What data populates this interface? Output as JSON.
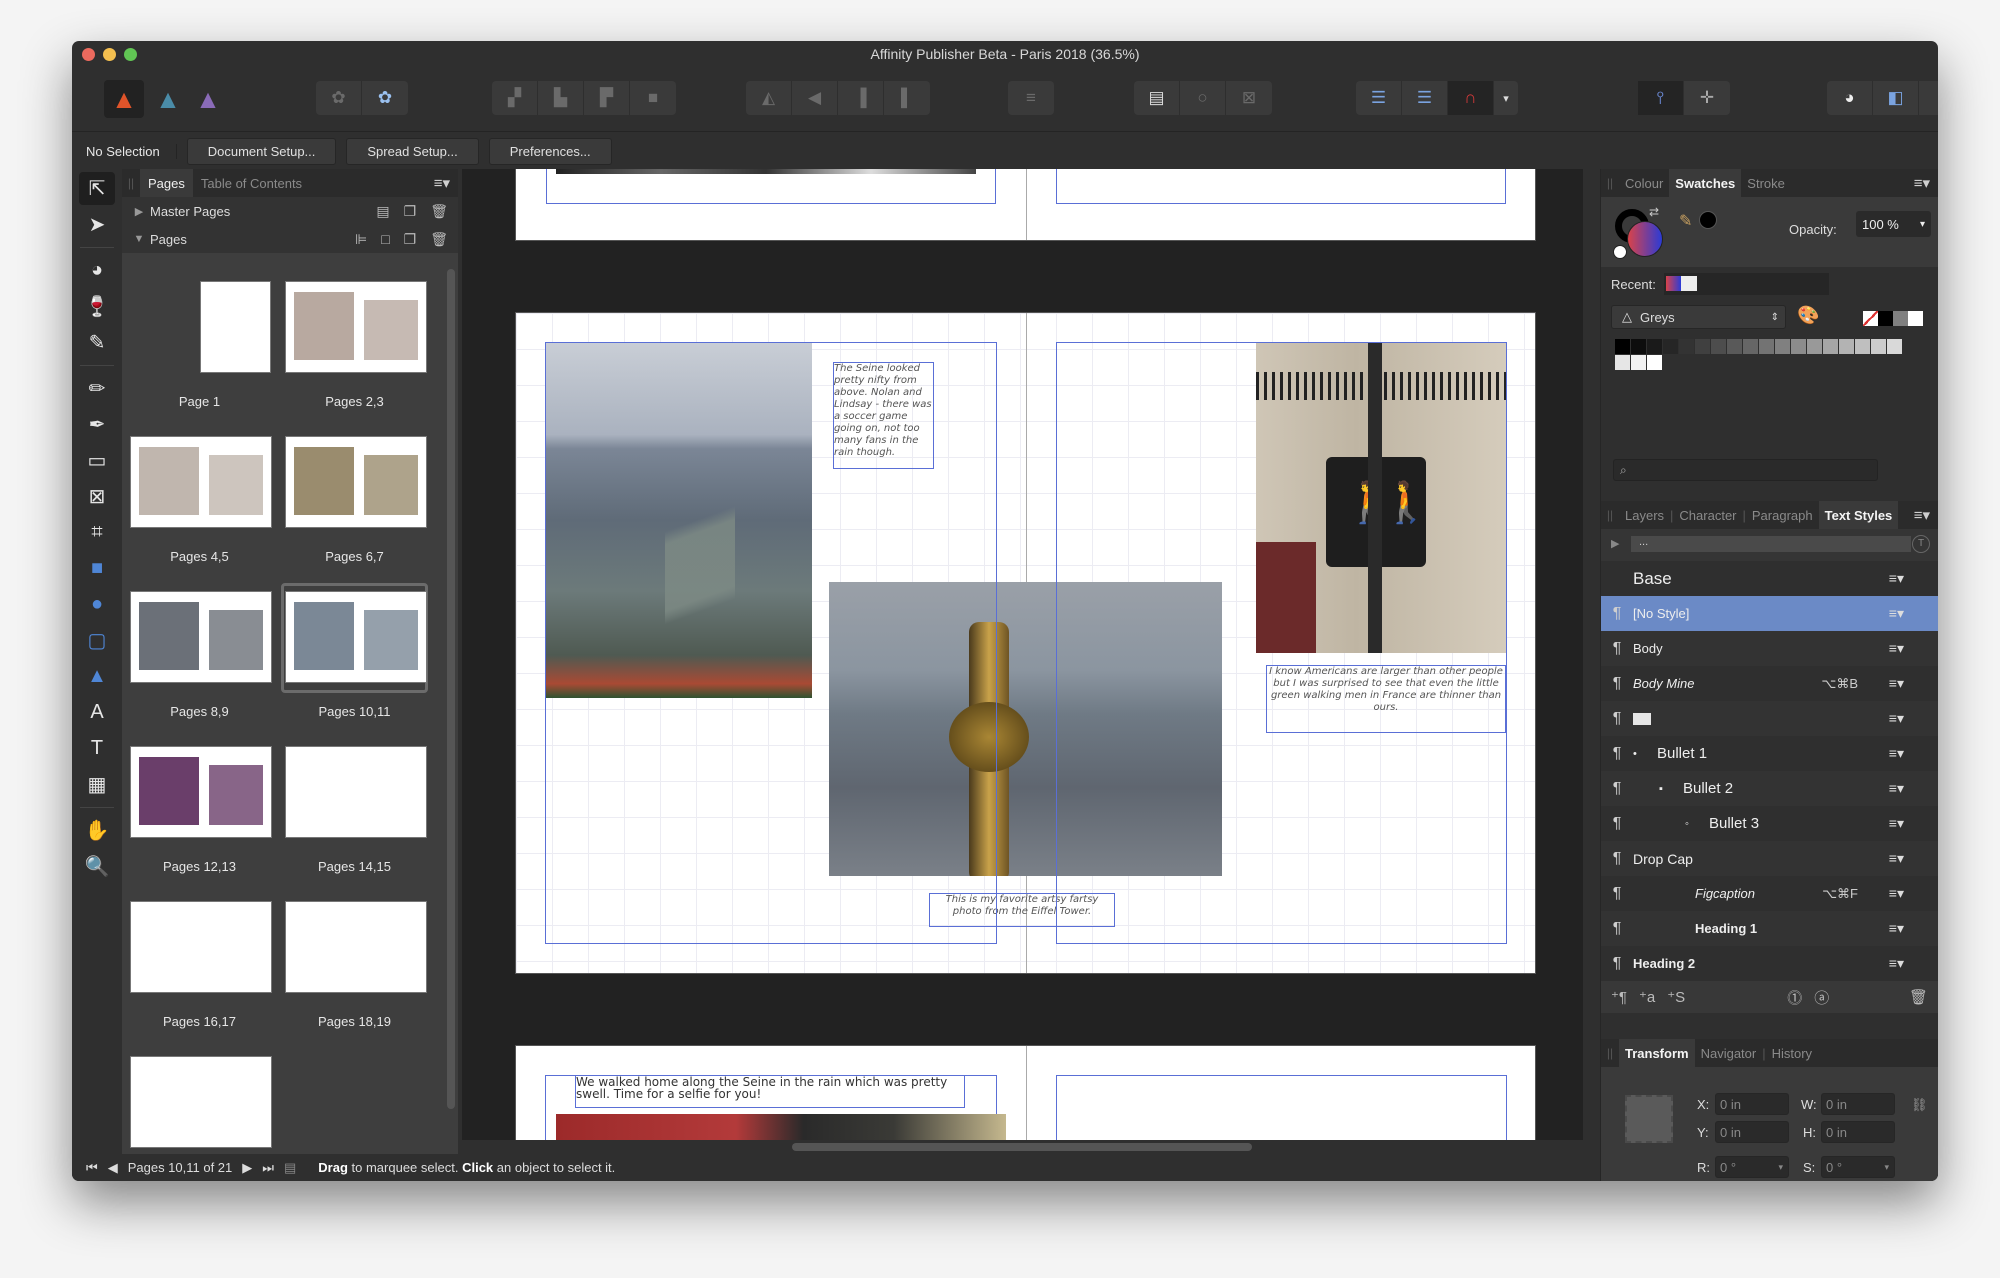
{
  "window": {
    "title": "Affinity Publisher Beta - Paris 2018 (36.5%)"
  },
  "toolbar": {
    "personas": [
      {
        "name": "publisher-persona",
        "glyph": "▲",
        "color": "#e0542a",
        "active": true
      },
      {
        "name": "designer-persona",
        "glyph": "▲",
        "color": "#4a8ca8",
        "active": false
      },
      {
        "name": "photo-persona",
        "glyph": "▲",
        "color": "#8a6bb8",
        "active": false
      }
    ],
    "snapping_dropdown": "▾"
  },
  "context": {
    "selection_label": "No Selection",
    "buttons": [
      "Document Setup...",
      "Spread Setup...",
      "Preferences..."
    ]
  },
  "tools": [
    {
      "name": "move-tool",
      "glyph": "⇱",
      "active": true
    },
    {
      "name": "node-tool",
      "glyph": "➤"
    },
    {
      "sep": true
    },
    {
      "name": "colour-picker-tool",
      "glyph": "◕"
    },
    {
      "name": "transparency-tool",
      "glyph": "🍷"
    },
    {
      "name": "eyedropper-tool",
      "glyph": "✎"
    },
    {
      "sep": true
    },
    {
      "name": "pencil-tool",
      "glyph": "✏"
    },
    {
      "name": "pen-tool",
      "glyph": "✒"
    },
    {
      "name": "place-image-tool",
      "glyph": "▭"
    },
    {
      "name": "picture-frame-tool",
      "glyph": "⊠"
    },
    {
      "name": "crop-tool",
      "glyph": "⌗"
    },
    {
      "name": "rectangle-tool",
      "glyph": "■"
    },
    {
      "name": "ellipse-tool",
      "glyph": "●"
    },
    {
      "name": "rounded-rectangle-tool",
      "glyph": "▢"
    },
    {
      "name": "triangle-tool",
      "glyph": "▲"
    },
    {
      "name": "artistic-text-tool",
      "glyph": "A"
    },
    {
      "name": "frame-text-tool",
      "glyph": "T"
    },
    {
      "name": "table-tool",
      "glyph": "▦"
    },
    {
      "sep": true
    },
    {
      "name": "hand-tool",
      "glyph": "✋"
    },
    {
      "name": "zoom-tool",
      "glyph": "🔍"
    }
  ],
  "pages_panel": {
    "tabs": [
      "Pages",
      "Table of Contents"
    ],
    "active_tab": "Pages",
    "sections": [
      "Master Pages",
      "Pages"
    ],
    "thumbnails": [
      {
        "label": "Page 1",
        "single": true
      },
      {
        "label": "Pages 2,3"
      },
      {
        "label": "Pages 4,5"
      },
      {
        "label": "Pages 6,7"
      },
      {
        "label": "Pages 8,9"
      },
      {
        "label": "Pages 10,11",
        "selected": true
      },
      {
        "label": "Pages 12,13"
      },
      {
        "label": "Pages 14,15"
      },
      {
        "label": "Pages 16,17"
      },
      {
        "label": "Pages 18,19"
      },
      {
        "label": "",
        "single": false
      }
    ]
  },
  "canvas": {
    "text_frames": {
      "seine": "The Seine looked pretty nifty from above.  Nolan and Lindsay - there was a soccer game going on, not too many fans in the rain though.",
      "americans": "I know Americans are larger than other people but I was surprised to see that even the little green walking men in France are thinner than ours.",
      "artsy": "This is my favorite artsy fartsy photo from the Eiffel Tower.",
      "walked": "We walked home along the Seine in the rain which was pretty swell. Time for a selfie for you!"
    }
  },
  "swatches_panel": {
    "tabs": [
      "Colour",
      "Swatches",
      "Stroke"
    ],
    "active_tab": "Swatches",
    "opacity_label": "Opacity:",
    "opacity_value": "100 %",
    "recent_label": "Recent:",
    "palette": "Greys",
    "fill_gradient": [
      "#d9434a",
      "#2b3bd6"
    ],
    "greys": [
      "#000000",
      "#0d0d0d",
      "#1a1a1a",
      "#262626",
      "#333333",
      "#404040",
      "#4d4d4d",
      "#595959",
      "#666666",
      "#737373",
      "#808080",
      "#8c8c8c",
      "#999999",
      "#a6a6a6",
      "#b3b3b3",
      "#bfbfbf",
      "#cccccc",
      "#d9d9d9",
      "#e6e6e6",
      "#f2f2f2",
      "#ffffff"
    ],
    "search_placeholder": ""
  },
  "text_styles_panel": {
    "tabs": [
      "Layers",
      "Character",
      "Paragraph",
      "Text Styles"
    ],
    "active_tab": "Text Styles",
    "filter_text": "...",
    "group": "Base",
    "styles": [
      {
        "name": "[No Style]",
        "selected": true
      },
      {
        "name": "Body"
      },
      {
        "name": "Body Mine",
        "shortcut": "⌥⌘B",
        "italic": true
      },
      {
        "name": "",
        "swatch": true
      },
      {
        "name": "Bullet 1",
        "bullet": "•",
        "indent": 0
      },
      {
        "name": "Bullet 2",
        "bullet": "▪",
        "indent": 1
      },
      {
        "name": "Bullet 3",
        "bullet": "◦",
        "indent": 2
      },
      {
        "name": "Drop Cap",
        "dropcap": true
      },
      {
        "name": "Figcaption",
        "shortcut": "⌥⌘F",
        "italic": true,
        "center": true
      },
      {
        "name": "Heading 1",
        "bold": true,
        "center": true
      },
      {
        "name": "Heading 2",
        "bold": true
      }
    ]
  },
  "transform_panel": {
    "tabs": [
      "Transform",
      "Navigator",
      "History"
    ],
    "active_tab": "Transform",
    "fields": {
      "x": "0 in",
      "y": "0 in",
      "w": "0 in",
      "h": "0 in",
      "r": "0 °",
      "s": "0 °"
    },
    "labels": {
      "x": "X:",
      "y": "Y:",
      "w": "W:",
      "h": "H:",
      "r": "R:",
      "s": "S:"
    }
  },
  "status": {
    "page_indicator": "Pages 10,11 of 21",
    "hint_drag": "Drag",
    "hint_mid": " to marquee select. ",
    "hint_click": "Click",
    "hint_end": " an object to select it."
  }
}
